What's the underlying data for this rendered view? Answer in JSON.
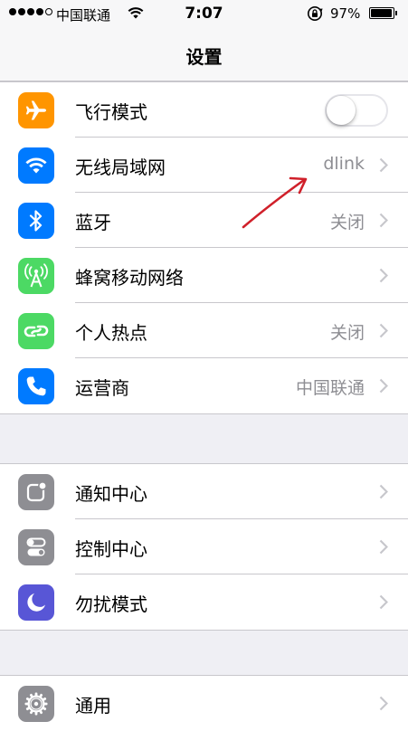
{
  "status_bar": {
    "carrier": "中国联通",
    "time": "7:07",
    "battery_percent": "97%",
    "battery_level": 0.97,
    "signal_bars": 4
  },
  "nav": {
    "title": "设置"
  },
  "groups": [
    {
      "rows": [
        {
          "label": "飞行模式",
          "icon": "airplane-icon",
          "icon_color": "#ff9500",
          "control": "toggle",
          "toggle_on": false
        },
        {
          "label": "无线局域网",
          "icon": "wifi-icon",
          "icon_color": "#007aff",
          "value": "dlink",
          "control": "chevron"
        },
        {
          "label": "蓝牙",
          "icon": "bluetooth-icon",
          "icon_color": "#007aff",
          "value": "关闭",
          "control": "chevron"
        },
        {
          "label": "蜂窝移动网络",
          "icon": "cellular-icon",
          "icon_color": "#4cd964",
          "value": "",
          "control": "chevron"
        },
        {
          "label": "个人热点",
          "icon": "hotspot-icon",
          "icon_color": "#4cd964",
          "value": "关闭",
          "control": "chevron"
        },
        {
          "label": "运营商",
          "icon": "phone-icon",
          "icon_color": "#007aff",
          "value": "中国联通",
          "control": "chevron"
        }
      ]
    },
    {
      "rows": [
        {
          "label": "通知中心",
          "icon": "notification-center-icon",
          "icon_color": "#8e8e93",
          "value": "",
          "control": "chevron"
        },
        {
          "label": "控制中心",
          "icon": "control-center-icon",
          "icon_color": "#8e8e93",
          "value": "",
          "control": "chevron"
        },
        {
          "label": "勿扰模式",
          "icon": "moon-icon",
          "icon_color": "#5856d6",
          "value": "",
          "control": "chevron"
        }
      ]
    },
    {
      "rows": [
        {
          "label": "通用",
          "icon": "gear-icon",
          "icon_color": "#8e8e93",
          "value": "",
          "control": "chevron"
        }
      ]
    }
  ],
  "colors": {
    "background": "#efeff4",
    "separator": "#c8c7cc",
    "secondary_text": "#8e8e93",
    "annotation_arrow": "#d0202a"
  }
}
